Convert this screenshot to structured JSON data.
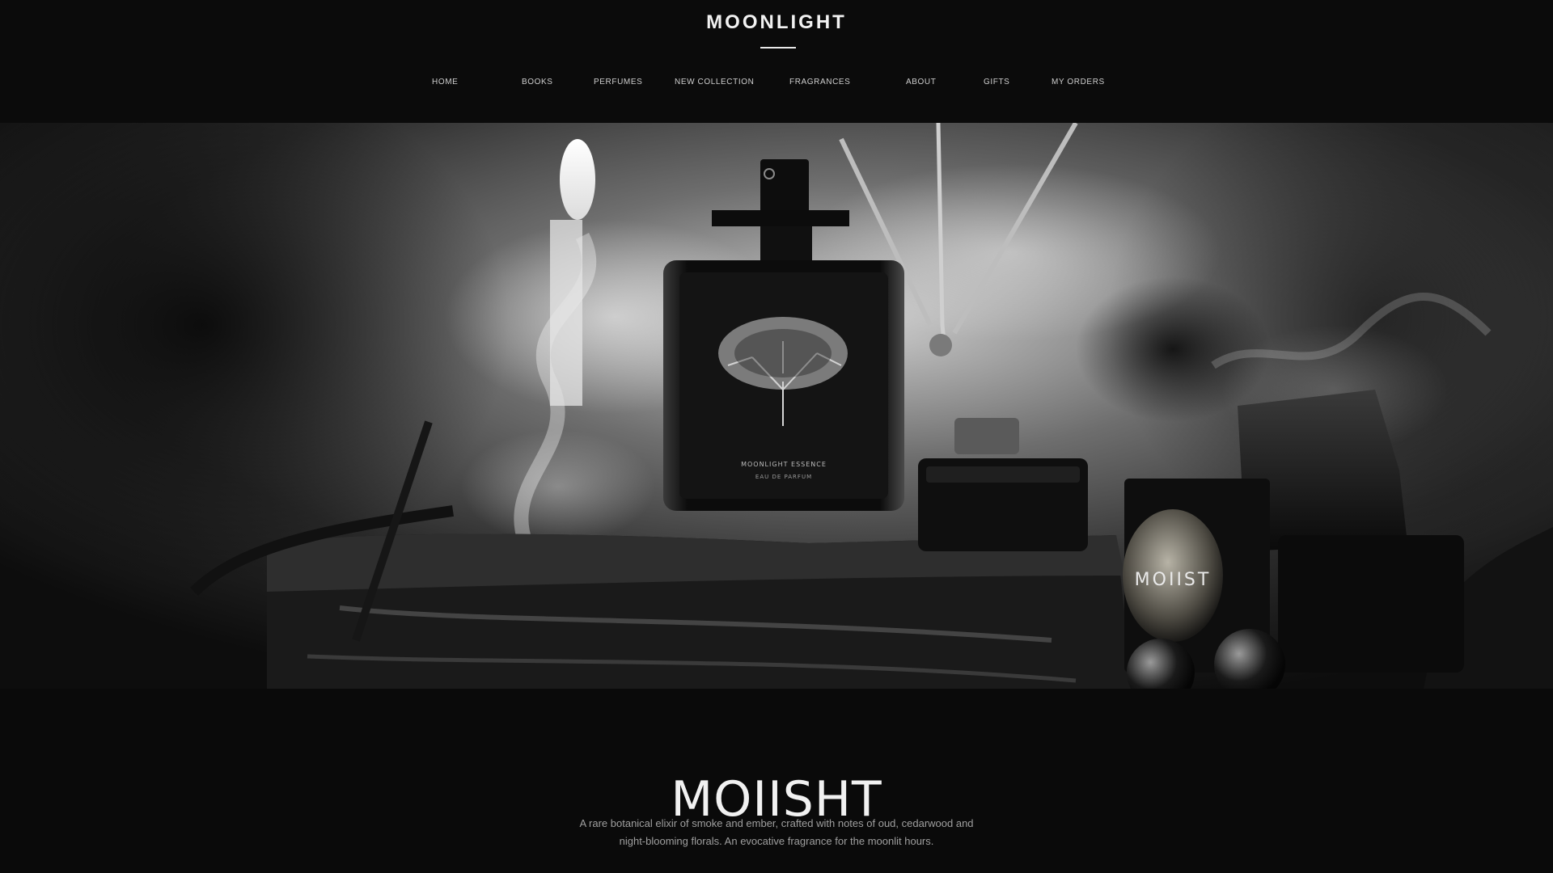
{
  "header": {
    "brand": "MOONLIGHT",
    "nav": [
      {
        "label": "HOME"
      },
      {
        "label": "BOOKS"
      },
      {
        "label": "PERFUMES"
      },
      {
        "label": "NEW COLLECTION"
      },
      {
        "label": "FRAGRANCES"
      },
      {
        "label": "ABOUT"
      },
      {
        "label": "GIFTS"
      },
      {
        "label": "MY ORDERS"
      }
    ]
  },
  "hero": {
    "bottle_label_line1": "MOONLIGHT ESSENCE",
    "bottle_label_line2": "EAU DE PARFUM",
    "box_label": "MOIIST"
  },
  "product": {
    "title": "MOIISHT",
    "description": "A rare botanical elixir of smoke and ember, crafted with notes of oud, cedarwood and night-blooming florals. An evocative fragrance for the moonlit hours."
  },
  "colors": {
    "background": "#0a0a0a",
    "text": "#f1f1f1",
    "muted": "#9f9f9f"
  }
}
